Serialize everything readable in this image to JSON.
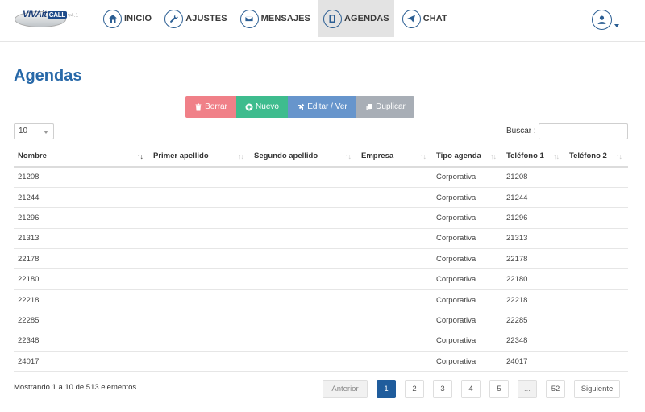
{
  "header": {
    "logo_brand": "VIVAit",
    "logo_call": "CALL",
    "logo_version": "v4.1",
    "nav": [
      {
        "label": "INICIO",
        "icon": "home-icon"
      },
      {
        "label": "AJUSTES",
        "icon": "wrench-icon"
      },
      {
        "label": "MENSAJES",
        "icon": "envelope-icon"
      },
      {
        "label": "AGENDAS",
        "icon": "book-icon",
        "active": true
      },
      {
        "label": "CHAT",
        "icon": "send-icon"
      }
    ],
    "user_icon": "user-icon"
  },
  "page": {
    "title": "Agendas"
  },
  "actions": {
    "delete": "Borrar",
    "new": "Nuevo",
    "edit": "Editar / Ver",
    "duplicate": "Duplicar"
  },
  "controls": {
    "length_value": "10",
    "search_label": "Buscar :",
    "search_value": ""
  },
  "table": {
    "columns": [
      "Nombre",
      "Primer apellido",
      "Segundo apellido",
      "Empresa",
      "Tipo agenda",
      "Teléfono 1",
      "Teléfono 2"
    ],
    "rows": [
      [
        "21208",
        "",
        "",
        "",
        "Corporativa",
        "21208",
        ""
      ],
      [
        "21244",
        "",
        "",
        "",
        "Corporativa",
        "21244",
        ""
      ],
      [
        "21296",
        "",
        "",
        "",
        "Corporativa",
        "21296",
        ""
      ],
      [
        "21313",
        "",
        "",
        "",
        "Corporativa",
        "21313",
        ""
      ],
      [
        "22178",
        "",
        "",
        "",
        "Corporativa",
        "22178",
        ""
      ],
      [
        "22180",
        "",
        "",
        "",
        "Corporativa",
        "22180",
        ""
      ],
      [
        "22218",
        "",
        "",
        "",
        "Corporativa",
        "22218",
        ""
      ],
      [
        "22285",
        "",
        "",
        "",
        "Corporativa",
        "22285",
        ""
      ],
      [
        "22348",
        "",
        "",
        "",
        "Corporativa",
        "22348",
        ""
      ],
      [
        "24017",
        "",
        "",
        "",
        "Corporativa",
        "24017",
        ""
      ]
    ]
  },
  "footer": {
    "info": "Mostrando 1 a 10 de 513 elementos",
    "pagination": {
      "previous": "Anterior",
      "pages": [
        "1",
        "2",
        "3",
        "4",
        "5"
      ],
      "ellipsis": "...",
      "last": "52",
      "next": "Siguiente",
      "current": "1"
    }
  },
  "colors": {
    "accent": "#2768a8",
    "delete": "#f08088",
    "new": "#3ebc8e",
    "edit": "#6795cc",
    "duplicate": "#a8aeb6",
    "active_page": "#1f5c9c"
  }
}
